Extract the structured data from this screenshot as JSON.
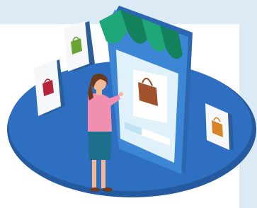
{
  "scene": "online-shopping-illustration",
  "colors": {
    "background_light_blue": "#dceaf6",
    "white_panel": "#ffffff",
    "platform_blue": "#2f6fc1",
    "platform_dark": "#245aa0",
    "phone_body": "#3d86d6",
    "phone_edge": "#2b67b0",
    "phone_screen": "#dff1fb",
    "awning_green": "#1fa77a",
    "awning_dark": "#13815c",
    "bag_brown": "#a0522d",
    "bag_green": "#6aa334",
    "bag_red": "#b8243a",
    "bag_orange": "#d9832a",
    "card_white": "#f6f7f9",
    "card_shadow": "#2b5d96",
    "woman_shirt": "#f08fb0",
    "woman_skirt": "#1e6f8c",
    "woman_hair": "#6b3a1d",
    "woman_skin": "#f1b996"
  },
  "icons": [
    "shopping-bag-icon",
    "shop-awning-icon",
    "smartphone-icon"
  ]
}
